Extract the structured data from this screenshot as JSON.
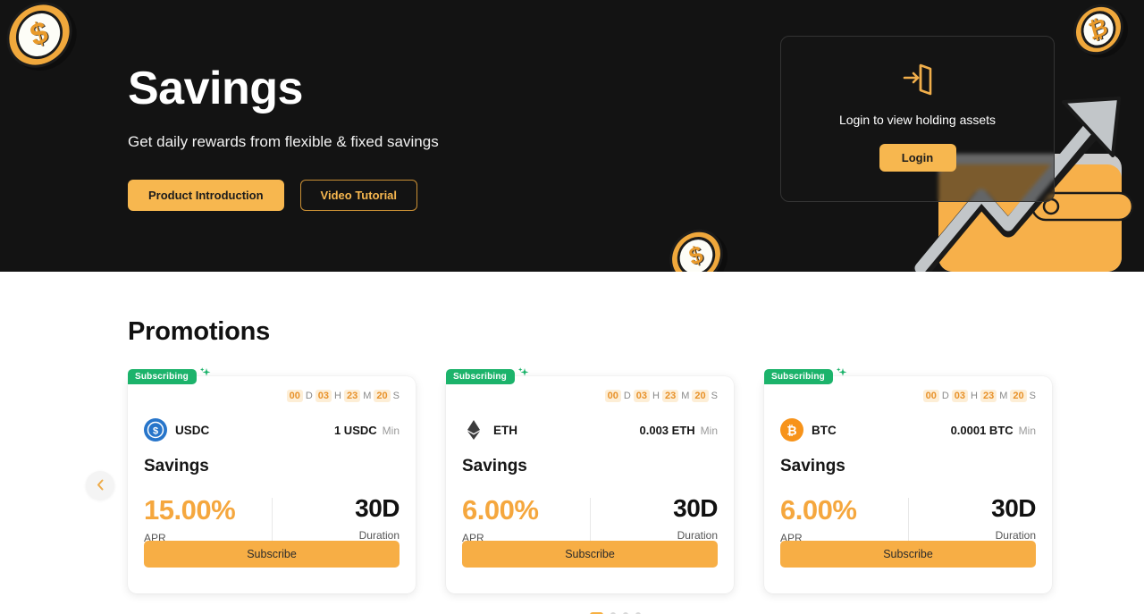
{
  "hero": {
    "title": "Savings",
    "subtitle": "Get daily rewards from flexible & fixed savings",
    "primary_button": "Product Introduction",
    "outline_button": "Video Tutorial",
    "coin_logo_symbol": "$",
    "coin_topright_symbol": "₿",
    "coin_bottom_symbol": "$",
    "background_color": "#131313",
    "accent_color": "#f7b74f"
  },
  "login_panel": {
    "icon": "login-door-icon",
    "message": "Login to view holding assets",
    "button_label": "Login"
  },
  "promotions": {
    "title": "Promotions",
    "prev_label": "‹",
    "next_label": "›",
    "dots": [
      {
        "active": true
      },
      {
        "active": false
      },
      {
        "active": false
      },
      {
        "active": false
      }
    ],
    "cards": [
      {
        "badge": "Subscribing",
        "countdown": {
          "days": "00",
          "d": "D",
          "hours": "03",
          "h": "H",
          "minutes": "23",
          "m": "M",
          "seconds": "20",
          "s": "S"
        },
        "asset_symbol": "USDC",
        "asset_icon": "usdc-icon",
        "asset_icon_color": "#2775ca",
        "min_value": "1 USDC",
        "min_label": "Min",
        "product": "Savings",
        "apr_value": "15.00%",
        "apr_label": "APR",
        "duration_value": "30D",
        "duration_label": "Duration",
        "subscribe_label": "Subscribe"
      },
      {
        "badge": "Subscribing",
        "countdown": {
          "days": "00",
          "d": "D",
          "hours": "03",
          "h": "H",
          "minutes": "23",
          "m": "M",
          "seconds": "20",
          "s": "S"
        },
        "asset_symbol": "ETH",
        "asset_icon": "eth-icon",
        "asset_icon_color": "#3c3c3d",
        "min_value": "0.003 ETH",
        "min_label": "Min",
        "product": "Savings",
        "apr_value": "6.00%",
        "apr_label": "APR",
        "duration_value": "30D",
        "duration_label": "Duration",
        "subscribe_label": "Subscribe"
      },
      {
        "badge": "Subscribing",
        "countdown": {
          "days": "00",
          "d": "D",
          "hours": "03",
          "h": "H",
          "minutes": "23",
          "m": "M",
          "seconds": "20",
          "s": "S"
        },
        "asset_symbol": "BTC",
        "asset_icon": "btc-icon",
        "asset_icon_color": "#f7931a",
        "min_value": "0.0001 BTC",
        "min_label": "Min",
        "product": "Savings",
        "apr_value": "6.00%",
        "apr_label": "APR",
        "duration_value": "30D",
        "duration_label": "Duration",
        "subscribe_label": "Subscribe"
      }
    ]
  }
}
